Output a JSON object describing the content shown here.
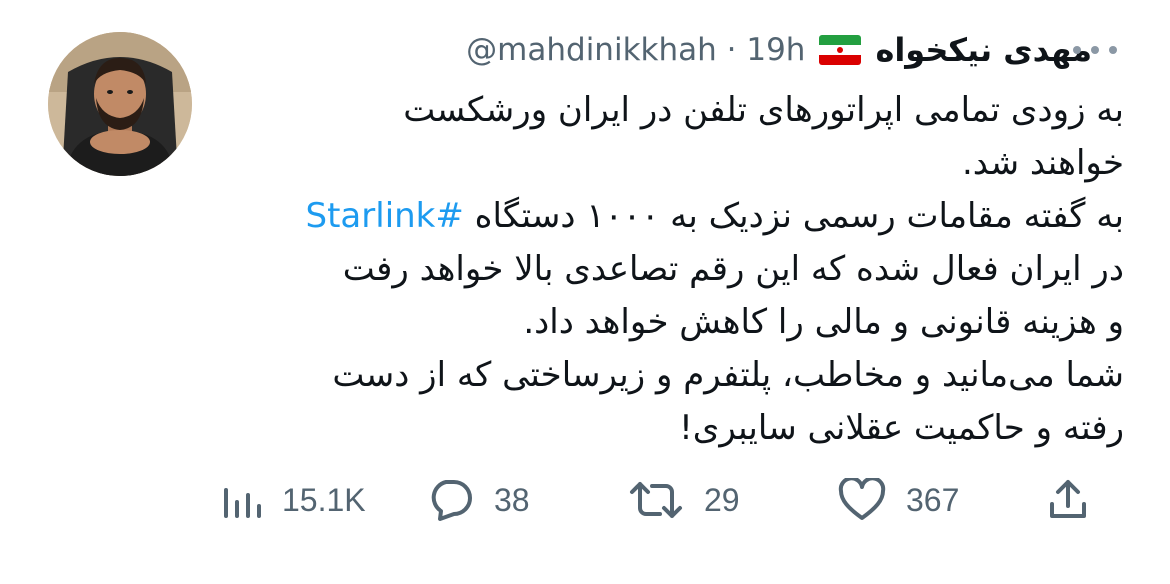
{
  "tweet": {
    "display_name": "مهدی نیکخواه",
    "handle": "@mahdinikkhah",
    "separator": "·",
    "time": "19h",
    "flag_icon": "iran-flag-icon",
    "text_lines": [
      "به زودی تمامی اپراتورهای تلفن در ایران ورشکست",
      "خواهند شد.",
      "به گفته مقامات رسمی نزدیک به ۱۰۰۰ دستگاه ",
      "در ایران فعال شده که این رقم تصاعدی بالا خواهد رفت",
      "و هزینه قانونی و مالی را کاهش خواهد داد.",
      "شما می‌مانید و مخاطب، پلتفرم و زیرساختی که از دست",
      "رفته و حاکمیت عقلانی سایبری!"
    ],
    "hashtag": "#Starlink",
    "accent_color": "#1d9bf0"
  },
  "actions": {
    "views": {
      "icon": "views-icon",
      "count": "15.1K"
    },
    "replies": {
      "icon": "reply-icon",
      "count": "38"
    },
    "retweets": {
      "icon": "retweet-icon",
      "count": "29"
    },
    "likes": {
      "icon": "like-icon",
      "count": "367"
    },
    "share": {
      "icon": "share-icon"
    }
  }
}
